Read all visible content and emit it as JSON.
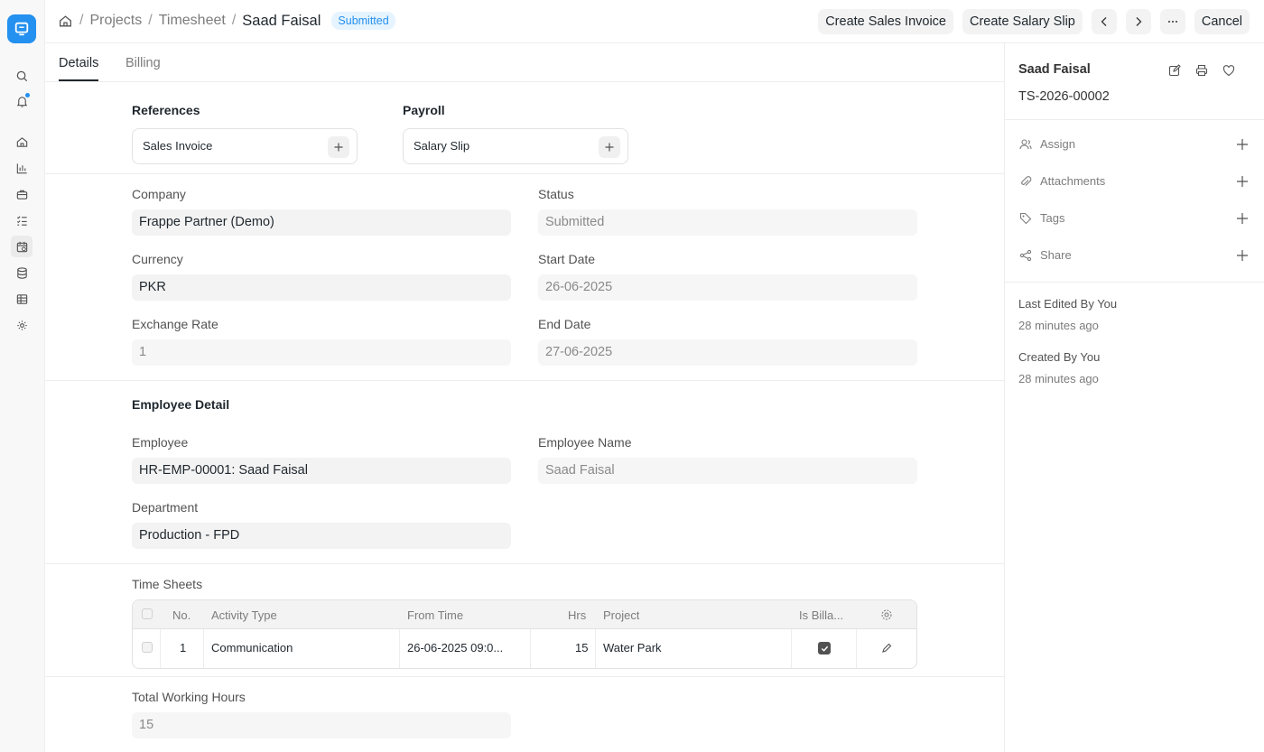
{
  "breadcrumb": {
    "items": [
      "Projects",
      "Timesheet"
    ],
    "current": "Saad Faisal",
    "status_badge": "Submitted"
  },
  "actions": {
    "create_sales_invoice": "Create Sales Invoice",
    "create_salary_slip": "Create Salary Slip",
    "cancel": "Cancel"
  },
  "tabs": [
    {
      "label": "Details"
    },
    {
      "label": "Billing"
    }
  ],
  "references": {
    "heading": "References",
    "link": "Sales Invoice"
  },
  "payroll": {
    "heading": "Payroll",
    "link": "Salary Slip"
  },
  "form": {
    "company_label": "Company",
    "company": "Frappe Partner (Demo)",
    "status_label": "Status",
    "status": "Submitted",
    "currency_label": "Currency",
    "currency": "PKR",
    "start_date_label": "Start Date",
    "start_date": "26-06-2025",
    "exchange_rate_label": "Exchange Rate",
    "exchange_rate": "1",
    "end_date_label": "End Date",
    "end_date": "27-06-2025"
  },
  "employee": {
    "heading": "Employee Detail",
    "employee_label": "Employee",
    "employee": "HR-EMP-00001: Saad Faisal",
    "employee_name_label": "Employee Name",
    "employee_name": "Saad Faisal",
    "department_label": "Department",
    "department": "Production - FPD"
  },
  "time_sheets": {
    "label": "Time Sheets",
    "columns": [
      "No.",
      "Activity Type",
      "From Time",
      "Hrs",
      "Project",
      "Is Billa..."
    ],
    "rows": [
      {
        "no": "1",
        "activity_type": "Communication",
        "from_time": "26-06-2025 09:0...",
        "hrs": "15",
        "project": "Water Park",
        "is_billable": true
      }
    ]
  },
  "totals": {
    "total_working_hours_label": "Total Working Hours",
    "total_working_hours": "15"
  },
  "sidebar": {
    "name": "Saad Faisal",
    "doc_id": "TS-2026-00002",
    "items": [
      {
        "label": "Assign",
        "icon": "assign-icon"
      },
      {
        "label": "Attachments",
        "icon": "paperclip-icon"
      },
      {
        "label": "Tags",
        "icon": "tag-icon"
      },
      {
        "label": "Share",
        "icon": "share-icon"
      }
    ],
    "last_edited": "Last Edited By You",
    "last_edited_time": "28 minutes ago",
    "created": "Created By You",
    "created_time": "28 minutes ago"
  },
  "colors": {
    "accent": "#2490ef",
    "badge_bg": "#e6f4ff",
    "field_bg": "#f3f3f3"
  }
}
